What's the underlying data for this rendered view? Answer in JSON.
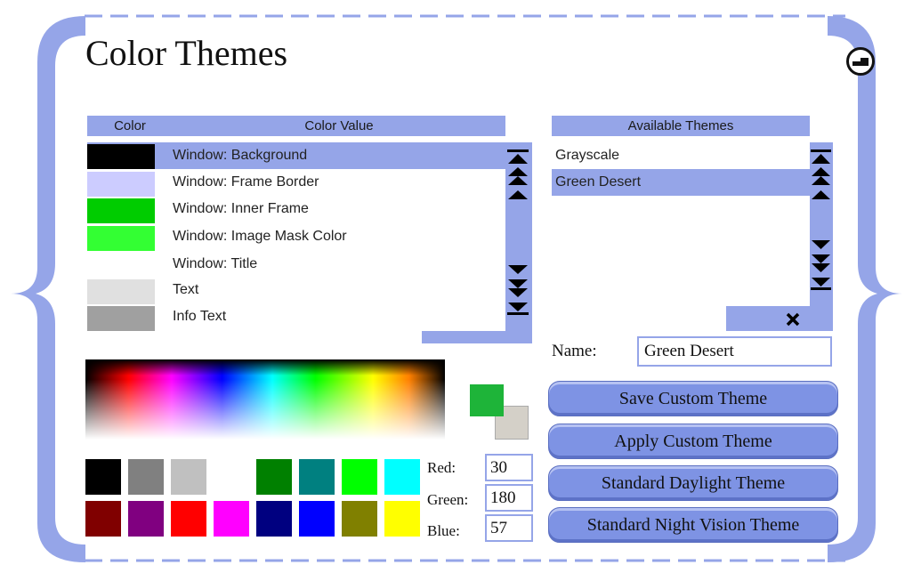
{
  "window": {
    "title": "Color Themes"
  },
  "color_list": {
    "header_color": "Color",
    "header_value": "Color Value",
    "items": [
      {
        "label": "Window: Background",
        "color": "#000000",
        "selected": true
      },
      {
        "label": "Window: Frame Border",
        "color": "#ccccff",
        "selected": false
      },
      {
        "label": "Window: Inner Frame",
        "color": "#00cc00",
        "selected": false
      },
      {
        "label": "Window: Image Mask Color",
        "color": "#33ff33",
        "selected": false
      },
      {
        "label": "Window: Title",
        "color": "#ffffff",
        "selected": false
      },
      {
        "label": "Text",
        "color": "#e0e0e0",
        "selected": false
      },
      {
        "label": "Info Text",
        "color": "#a0a0a0",
        "selected": false
      }
    ]
  },
  "themes": {
    "header": "Available Themes",
    "items": [
      {
        "label": "Grayscale",
        "selected": false
      },
      {
        "label": "Green Desert",
        "selected": true
      }
    ]
  },
  "name_field": {
    "label": "Name:",
    "value": "Green Desert"
  },
  "buttons": {
    "save": "Save Custom Theme",
    "apply": "Apply Custom Theme",
    "daylight": "Standard Daylight Theme",
    "night": "Standard Night Vision Theme"
  },
  "current_color": {
    "foreground": "#1eb439",
    "background": "#d4d0c8"
  },
  "palette": [
    "#000000",
    "#808080",
    "#c0c0c0",
    "#ffffff",
    "#008000",
    "#008080",
    "#00ff00",
    "#00ffff",
    "#800000",
    "#800080",
    "#ff0000",
    "#ff00ff",
    "#000080",
    "#0000ff",
    "#808000",
    "#ffff00"
  ],
  "rgb": {
    "red_label": "Red:",
    "green_label": "Green:",
    "blue_label": "Blue:",
    "red": "30",
    "green": "180",
    "blue": "57"
  },
  "accent": "#95a5e8"
}
